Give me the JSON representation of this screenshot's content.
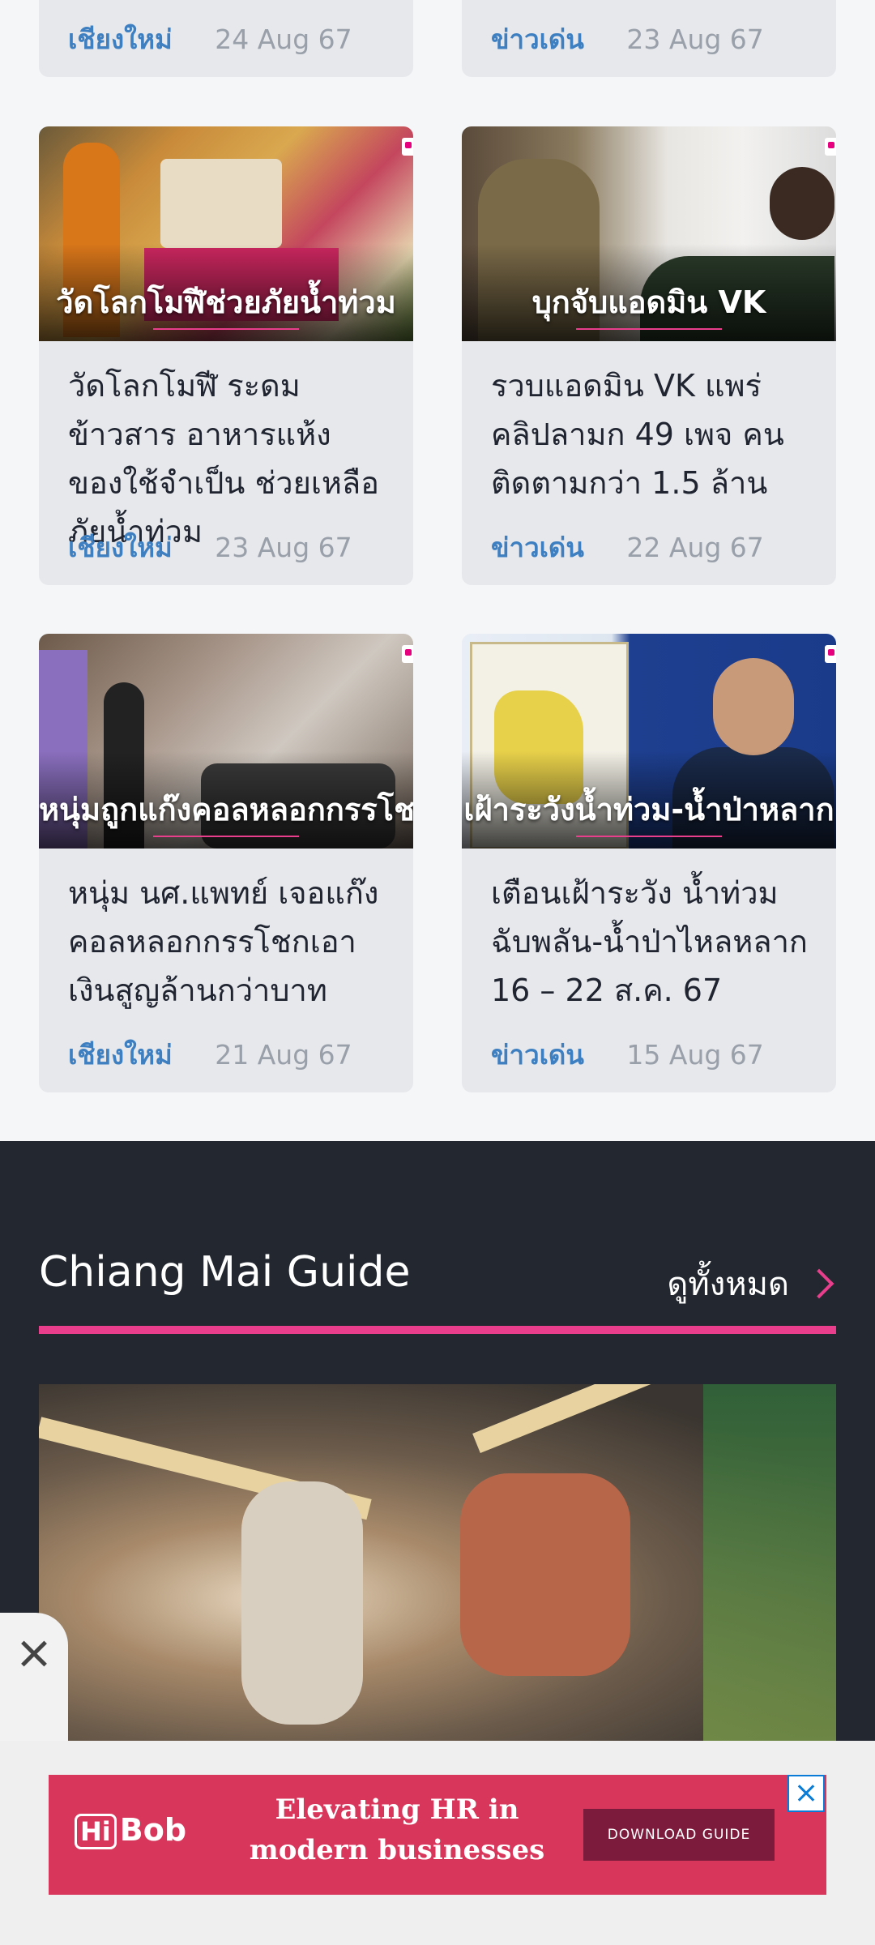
{
  "top_cards": [
    {
      "category": "เชียงใหม่",
      "date": "24 Aug 67"
    },
    {
      "category": "ข่าวเด่น",
      "date": "23 Aug 67"
    }
  ],
  "cards": [
    {
      "caption": "วัดโลกโมฬีช่วยภัยน้ำท่วม",
      "title": "วัดโลกโมฬี ระดมข้าวสาร อาหารแห้ง ของใช้จำเป็น ช่วยเหลือภัยน้ำท่วม",
      "category": "เชียงใหม่",
      "date": "23 Aug 67"
    },
    {
      "caption": "บุกจับแอดมิน VK",
      "title": "รวบแอดมิน VK แพร่คลิปลามก 49 เพจ คนติดตามกว่า 1.5 ล้าน",
      "category": "ข่าวเด่น",
      "date": "22 Aug 67"
    },
    {
      "caption": "หนุ่มถูกแก๊งคอลหลอกกรรโชก",
      "title": "หนุ่ม นศ.แพทย์ เจอแก๊งคอลหลอกกรรโชกเอาเงินสูญล้านกว่าบาท",
      "category": "เชียงใหม่",
      "date": "21 Aug 67"
    },
    {
      "caption": "เฝ้าระวังน้ำท่วม-น้ำป่าหลาก",
      "title": "เตือนเฝ้าระวัง น้ำท่วมฉับพลัน-น้ำป่าไหลหลาก 16 – 22 ส.ค. 67",
      "category": "ข่าวเด่น",
      "date": "15 Aug 67"
    }
  ],
  "guide_section": {
    "title": "Chiang Mai Guide",
    "see_all": "ดูทั้งหมด"
  },
  "ad": {
    "logo_hi": "Hi",
    "logo_bob": "Bob",
    "line1": "Elevating HR in",
    "line2": "modern businesses",
    "button": "DOWNLOAD GUIDE"
  },
  "colors": {
    "accent": "#e83e8c",
    "category": "#3d7fc0",
    "dark_bg": "#232830",
    "ad_bg": "#d8365b"
  }
}
